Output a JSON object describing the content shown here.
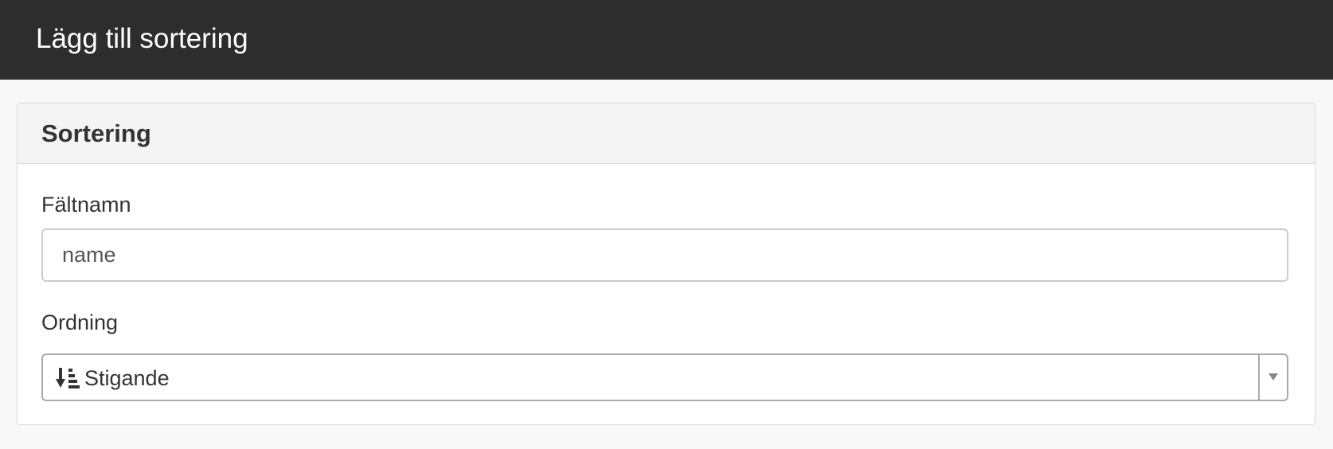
{
  "window": {
    "title": "Lägg till sortering"
  },
  "panel": {
    "heading": "Sortering",
    "field_name": {
      "label": "Fältnamn",
      "value": "name"
    },
    "order": {
      "label": "Ordning",
      "selected": "Stigande",
      "icon": "sort-ascending-icon"
    }
  },
  "colors": {
    "titlebar_bg": "#2d2d2d",
    "page_bg": "#f8f8f8",
    "panel_heading_bg": "#f4f4f4"
  }
}
